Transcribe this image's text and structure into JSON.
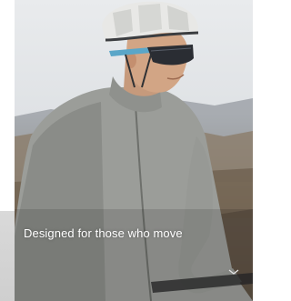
{
  "hero": {
    "tagline": "Designed for those who move",
    "scroll_icon": "chevron-down-icon"
  },
  "colors": {
    "tagline_text": "#ffffff",
    "sky": "#e4e7ea",
    "jacket": "#9a9c98",
    "helmet": "#e8e8e6",
    "glass_frame": "#5aa6c8",
    "lens": "#2a2d33"
  }
}
